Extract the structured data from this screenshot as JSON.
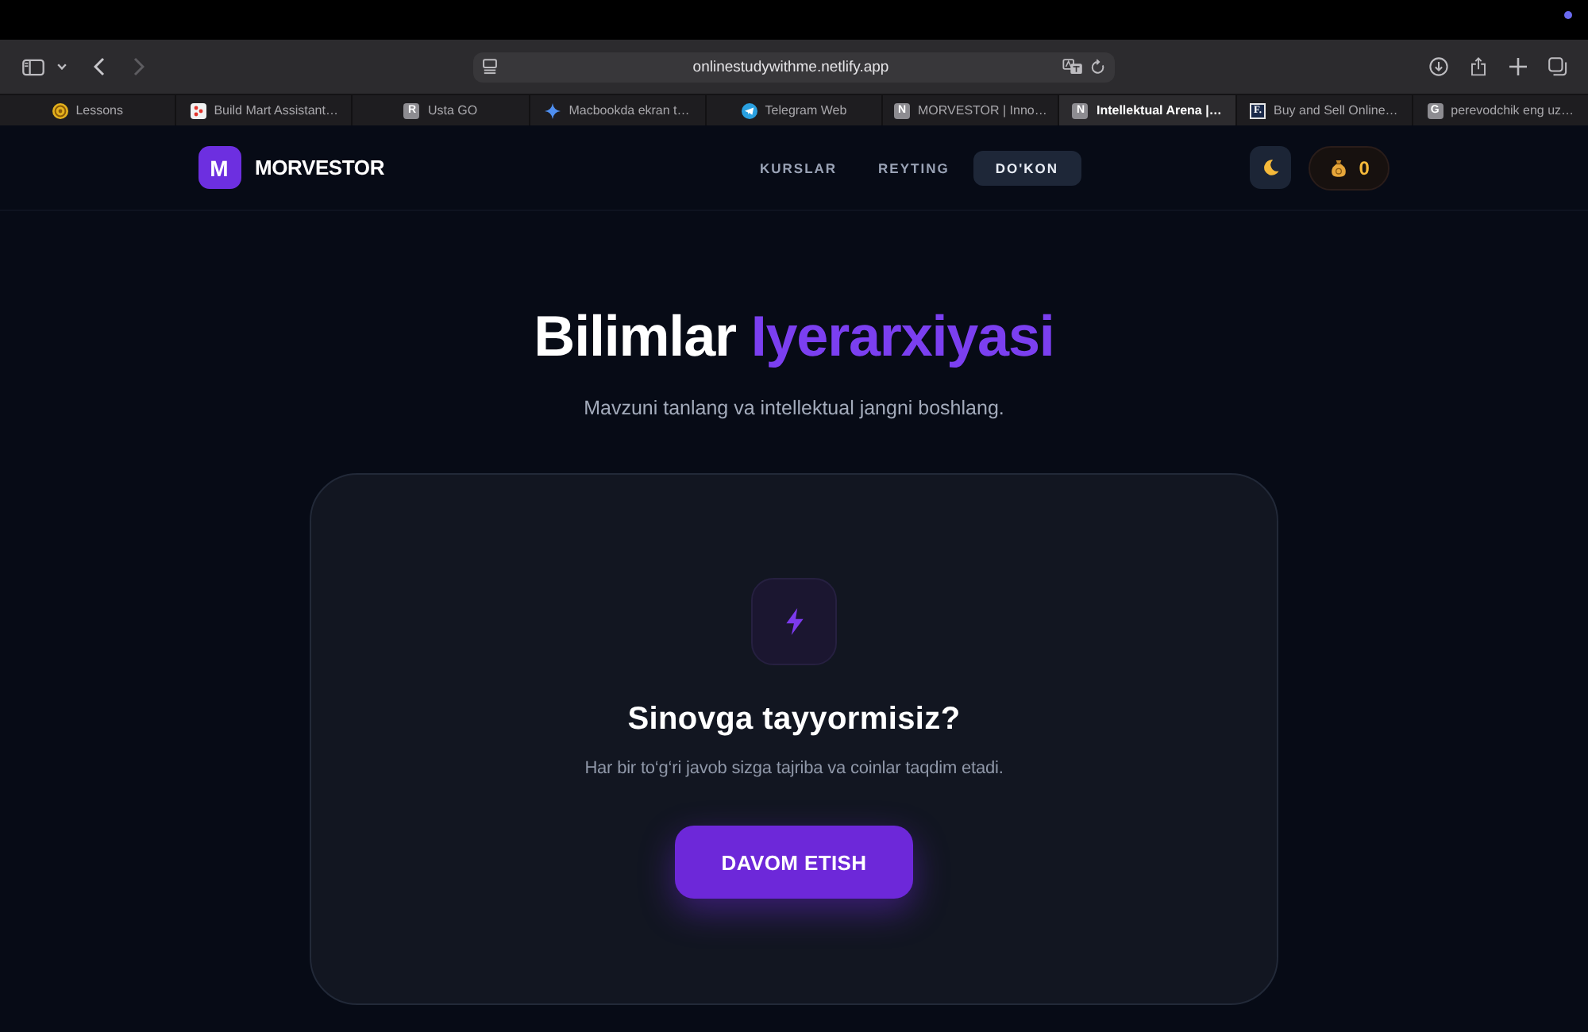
{
  "browser": {
    "nav_buttons": [
      {
        "kind": "back",
        "disabled": false
      },
      {
        "kind": "forward",
        "disabled": true
      }
    ],
    "address_bar": {
      "url": "onlinestudywithme.netlify.app"
    },
    "tabs": [
      {
        "title": "Lessons",
        "selected": false,
        "favicon": {
          "kind": "emblem"
        }
      },
      {
        "title": "Build Mart Assistant…",
        "selected": false,
        "favicon": {
          "kind": "dots"
        }
      },
      {
        "title": "Usta GO",
        "selected": false,
        "favicon": {
          "kind": "letter",
          "text": "R"
        }
      },
      {
        "title": "Macbookda ekran t…",
        "selected": false,
        "favicon": {
          "kind": "sparkle"
        }
      },
      {
        "title": "Telegram Web",
        "selected": false,
        "favicon": {
          "kind": "plane"
        }
      },
      {
        "title": "MORVESTOR | Inno…",
        "selected": false,
        "favicon": {
          "kind": "letter",
          "text": "N"
        }
      },
      {
        "title": "Intellektual Arena |…",
        "selected": true,
        "favicon": {
          "kind": "letter",
          "text": "N"
        }
      },
      {
        "title": "Buy and Sell Online…",
        "selected": false,
        "favicon": {
          "kind": "framed_letter",
          "text": "F."
        }
      },
      {
        "title": "perevodchik eng uz…",
        "selected": false,
        "favicon": {
          "kind": "letter",
          "text": "G"
        }
      }
    ]
  },
  "header": {
    "logo": {
      "mark": "M",
      "name": "MORVESTOR"
    },
    "nav": [
      {
        "label": "KURSLAR",
        "selected": false
      },
      {
        "label": "REYTING",
        "selected": false
      },
      {
        "label": "DO'KON",
        "selected": true
      }
    ],
    "coins": {
      "value": "0"
    }
  },
  "hero": {
    "title": [
      {
        "text": "Bilimlar",
        "accent": false
      },
      {
        "text": "Iyerarxiyasi",
        "accent": true
      }
    ],
    "subtitle": "Mavzuni tanlang va intellektual jangni boshlang."
  },
  "card": {
    "title": "Sinovga tayyormisiz?",
    "description": "Har bir to‘g‘ri javob sizga tajriba va coinlar taqdim etadi.",
    "button": "DAVOM ETISH"
  }
}
